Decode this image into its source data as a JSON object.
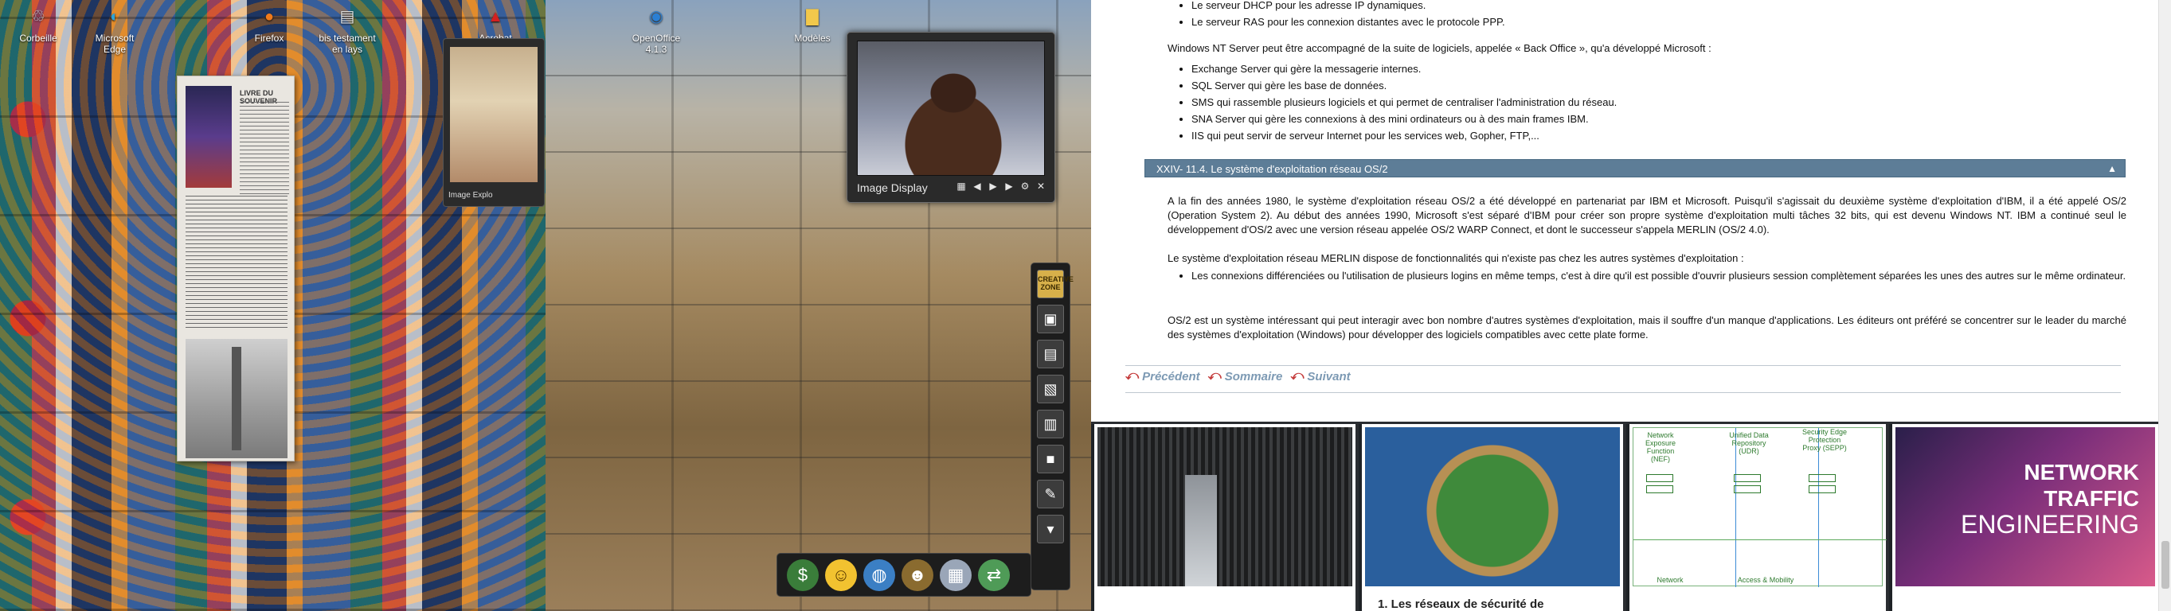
{
  "desktop": {
    "icons": [
      {
        "label": "Corbeille",
        "glyph": "♲",
        "color": "#cfd8e3"
      },
      {
        "label": "Microsoft Edge",
        "glyph": "◐",
        "color": "#2fa3d6"
      },
      {
        "label": "Firefox",
        "glyph": "●",
        "color": "#f07a1b"
      },
      {
        "label": "bis testament en lays",
        "glyph": "▤",
        "color": "#e8e8e8"
      },
      {
        "label": "Acrobat Reader DC",
        "glyph": "▲",
        "color": "#d32020"
      },
      {
        "label": "OpenOffice 4.1.3",
        "glyph": "◉",
        "color": "#2a7fd4"
      },
      {
        "label": "Modèles",
        "glyph": "▇",
        "color": "#f2c84b"
      }
    ],
    "leaflet_heading": "LIVRE DU SOUVENIR",
    "thumb_label": "Image Explo",
    "image_display": {
      "title": "Image Display"
    },
    "gadget_label": "CREATIVE ZONE"
  },
  "document": {
    "top_list": [
      "Le serveur DHCP pour les adresse IP dynamiques.",
      "Le serveur RAS pour les connexion distantes avec le protocole PPP."
    ],
    "intro": "Windows NT Server peut être accompagné de la suite de logiciels, appelée « Back Office », qu'a développé Microsoft :",
    "backoffice_list": [
      "Exchange Server qui gère la messagerie internes.",
      "SQL Server qui gère les base de données.",
      "SMS qui rassemble plusieurs logiciels et qui permet de centraliser l'administration du réseau.",
      "SNA Server qui gère les connexions à des mini ordinateurs ou à des main frames IBM.",
      "IIS qui peut servir de serveur Internet pour les services web, Gopher, FTP,..."
    ],
    "section_title": "XXIV- 11.4. Le système d'exploitation réseau OS/2",
    "para1": "A la fin des années 1980, le système d'exploitation réseau OS/2 a été développé en partenariat par IBM et Microsoft. Puisqu'il s'agissait du deuxième système d'exploitation d'IBM, il a été appelé OS/2 (Operation System 2). Au début des années 1990, Microsoft s'est séparé d'IBM pour créer son propre système d'exploitation multi tâches 32 bits, qui est devenu Windows NT. IBM a continué seul le développement d'OS/2 avec une version réseau appelée OS/2 WARP Connect, et dont le successeur s'appela MERLIN (OS/2 4.0).",
    "para2": "Le système d'exploitation réseau MERLIN dispose de fonctionnalités qui n'existe pas chez les autres systèmes d'exploitation :",
    "merlin_list": [
      "Les connexions différenciées ou l'utilisation de plusieurs logins en même temps, c'est à dire qu'il est possible d'ouvrir plusieurs session complètement séparées les unes des autres sur le même ordinateur."
    ],
    "para3": "OS/2 est un système intéressant qui peut interagir avec bon nombre d'autres systèmes d'exploitation, mais il souffre d'un manque d'applications. Les éditeurs ont préféré se concentrer sur le leader du marché des systèmes d'exploitation (Windows) pour développer des logiciels compatibles avec cette plate forme.",
    "nav": {
      "prev": "Précédent",
      "summary": "Sommaire",
      "next": "Suivant"
    }
  },
  "strip": {
    "card2_caption": "1. Les réseaux de sécurité de",
    "card3": {
      "nef": "Network Exposure Function (NEF)",
      "udr": "Unified Data Repository (UDR)",
      "sepp": "Security Edge Protection Proxy (SEPP)",
      "access": "Access & Mobility",
      "network": "Network"
    },
    "card4": {
      "line1": "NETWORK",
      "line2": "TRAFFIC",
      "line3": "ENGINEERING"
    }
  }
}
